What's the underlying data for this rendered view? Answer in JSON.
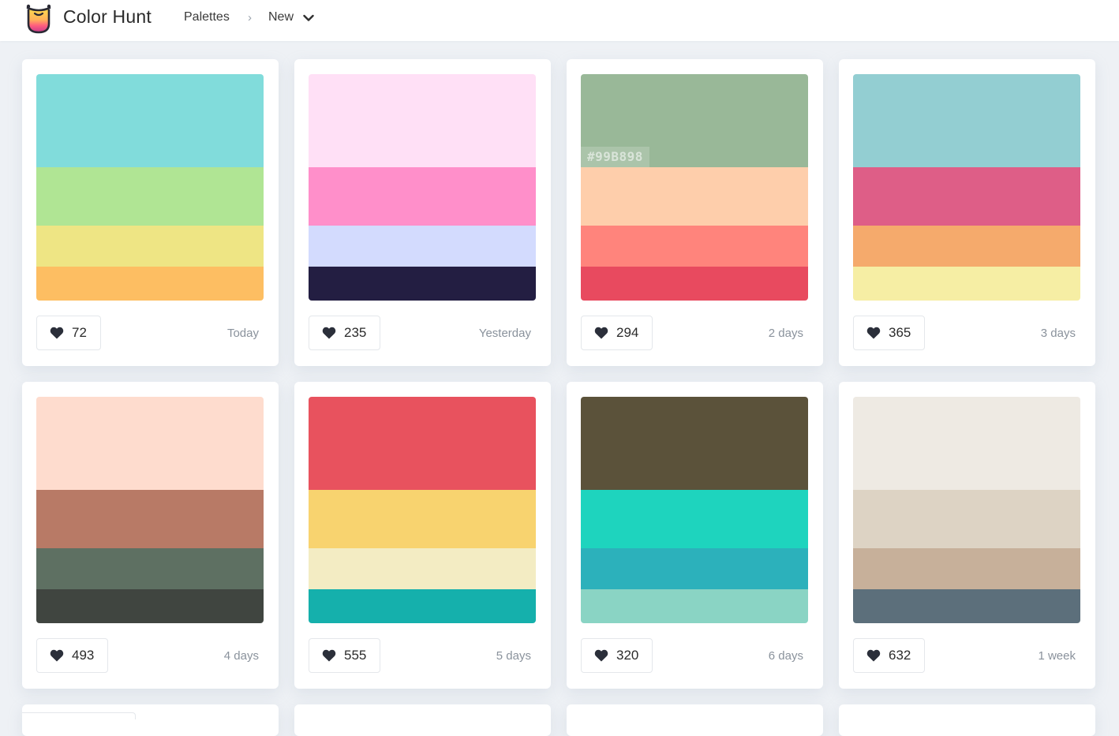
{
  "header": {
    "brand": "Color Hunt",
    "breadcrumb": {
      "palettes": "Palettes",
      "separator": "›",
      "current": "New"
    }
  },
  "palettes": [
    {
      "colors": [
        "#81DCDB",
        "#B0E594",
        "#EEE584",
        "#FDBE62"
      ],
      "likes": "72",
      "date": "Today"
    },
    {
      "colors": [
        "#FFE0F6",
        "#FF8FCA",
        "#D3DBFE",
        "#231E42"
      ],
      "likes": "235",
      "date": "Yesterday"
    },
    {
      "colors": [
        "#99B898",
        "#FECEAB",
        "#FF847C",
        "#E84A5F"
      ],
      "likes": "294",
      "date": "2 days",
      "hover_hex": "#99B898"
    },
    {
      "colors": [
        "#93CED2",
        "#DE5E87",
        "#F5AA6C",
        "#F6EEA4"
      ],
      "likes": "365",
      "date": "3 days"
    },
    {
      "colors": [
        "#FEDCCE",
        "#B87A66",
        "#5E7062",
        "#404540"
      ],
      "likes": "493",
      "date": "4 days"
    },
    {
      "colors": [
        "#E8525E",
        "#F8D36F",
        "#F3ECC3",
        "#15B0AC"
      ],
      "likes": "555",
      "date": "5 days"
    },
    {
      "colors": [
        "#5B523A",
        "#1ED4BE",
        "#2CB1BB",
        "#8AD4C4"
      ],
      "likes": "320",
      "date": "6 days"
    },
    {
      "colors": [
        "#EEEAE3",
        "#DDD3C4",
        "#C7B09A",
        "#5C6F7B"
      ],
      "likes": "632",
      "date": "1 week"
    }
  ]
}
